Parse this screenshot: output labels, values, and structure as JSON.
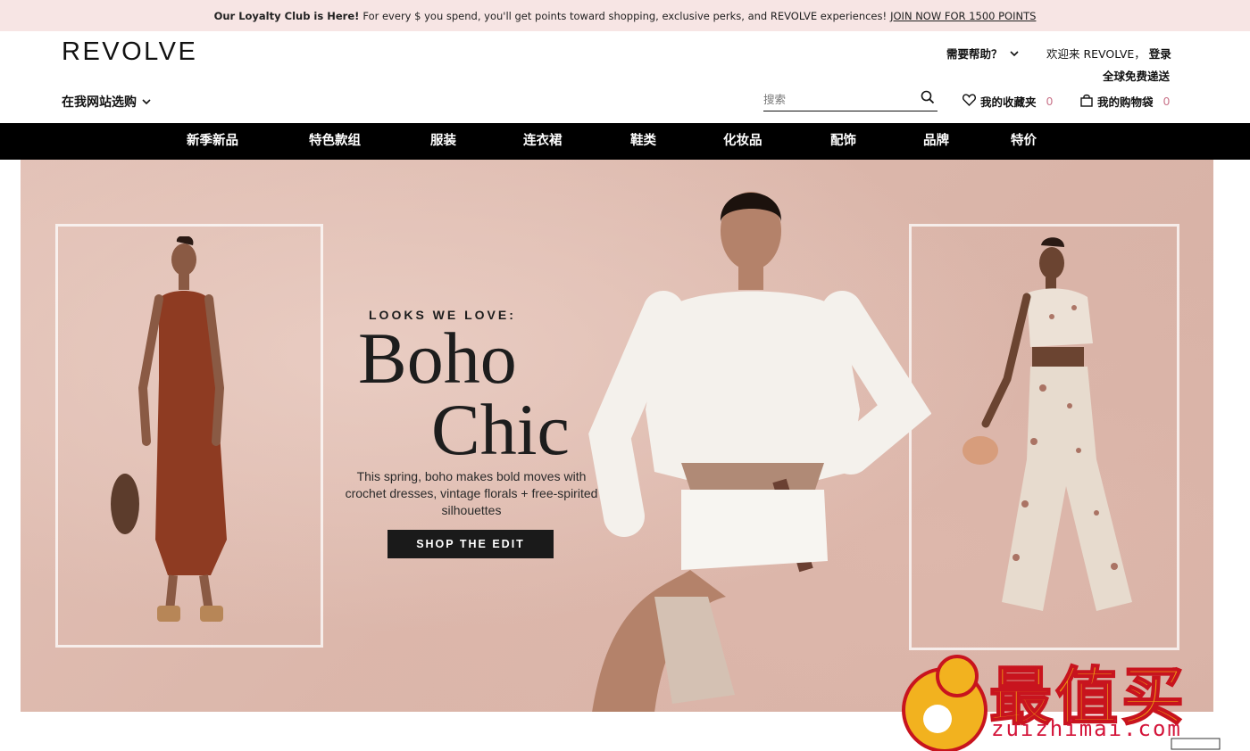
{
  "promo": {
    "bold": "Our Loyalty Club is Here!",
    "text": "For every $ you spend, you'll get points toward shopping, exclusive perks, and REVOLVE experiences!",
    "link": "JOIN NOW FOR 1500 POINTS"
  },
  "header": {
    "logo": "REVOLVE",
    "help": "需要帮助？",
    "welcome": "欢迎来 REVOLVE，",
    "login": "登录",
    "free_shipping": "全球免费递送",
    "country_selector": "在我网站选购",
    "search_placeholder": "搜索",
    "wishlist_label": "我的收藏夹",
    "wishlist_count": "0",
    "bag_label": "我的购物袋",
    "bag_count": "0"
  },
  "nav": {
    "items": [
      {
        "label": "新季新品"
      },
      {
        "label": "特色款组"
      },
      {
        "label": "服装"
      },
      {
        "label": "连衣裙"
      },
      {
        "label": "鞋类"
      },
      {
        "label": "化妆品"
      },
      {
        "label": "配饰"
      },
      {
        "label": "品牌"
      },
      {
        "label": "特价"
      }
    ]
  },
  "hero": {
    "kicker": "LOOKS WE LOVE:",
    "title_line1": "Boho",
    "title_line2": "Chic",
    "description": "This spring, boho makes bold moves with crochet dresses, vintage florals + free-spirited silhouettes",
    "cta": "SHOP THE EDIT"
  },
  "watermark": {
    "text": "最值买",
    "url": "zuizhimai.com"
  },
  "colors": {
    "promo_bg": "#f7e5e4",
    "nav_bg": "#000000",
    "count_pink": "#c9748a",
    "cta_bg": "#1a1a1a"
  },
  "icons": [
    "chevron-down-icon",
    "search-icon",
    "heart-icon",
    "bag-icon"
  ]
}
